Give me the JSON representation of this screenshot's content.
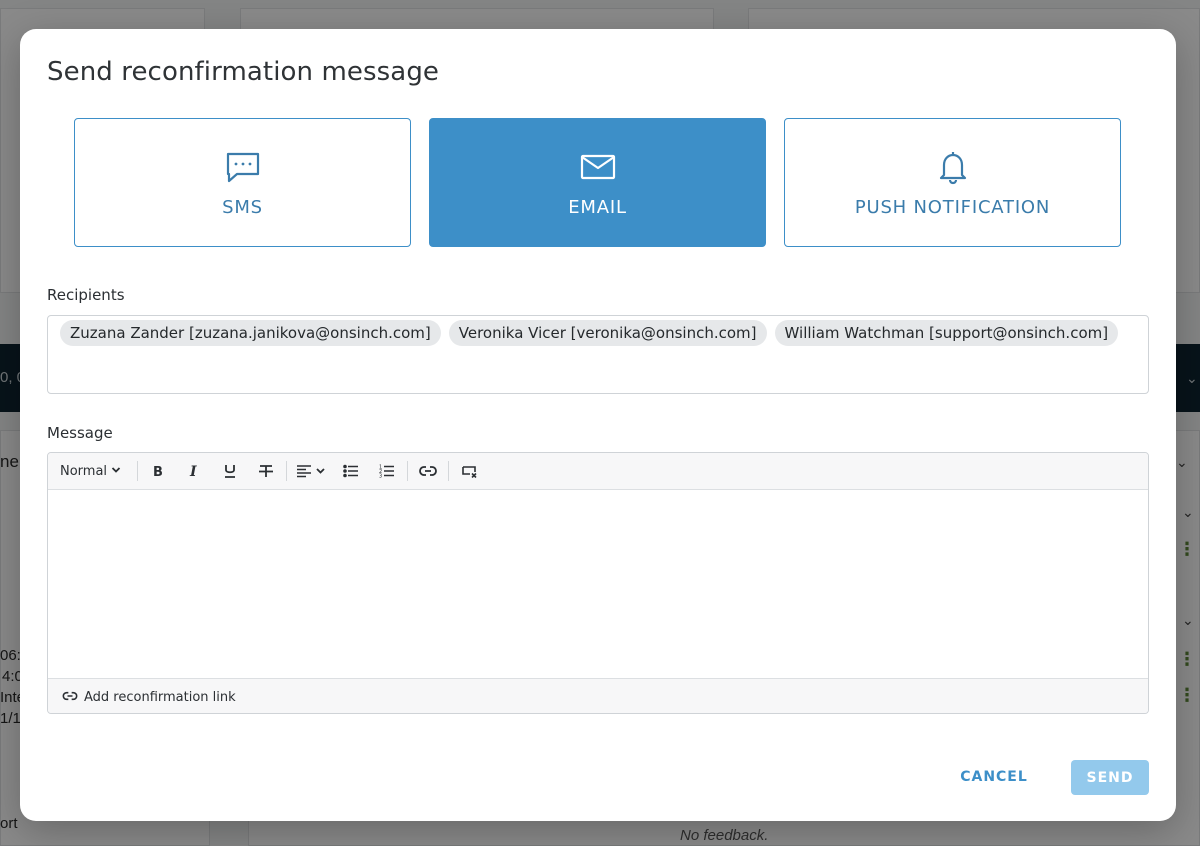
{
  "background": {
    "fragments": [
      "0, 0",
      "ne",
      "06:0",
      "4:0",
      "Inte",
      "1/1",
      "ort",
      "No feedback."
    ]
  },
  "modal": {
    "title": "Send reconfirmation message",
    "channels": [
      {
        "label": "SMS",
        "icon": "chat-bubble-icon",
        "selected": false
      },
      {
        "label": "EMAIL",
        "icon": "envelope-icon",
        "selected": true
      },
      {
        "label": "PUSH NOTIFICATION",
        "icon": "bell-icon",
        "selected": false
      }
    ],
    "recipients_label": "Recipients",
    "recipients": [
      "Zuzana Zander [zuzana.janikova@onsinch.com]",
      "Veronika Vicer [veronika@onsinch.com]",
      "William Watchman [support@onsinch.com]"
    ],
    "message_label": "Message",
    "toolbar": {
      "format_value": "Normal",
      "buttons": [
        "bold-icon",
        "italic-icon",
        "underline-icon",
        "strikethrough-icon",
        "align-icon",
        "bullet-list-icon",
        "ordered-list-icon",
        "link-icon",
        "clear-format-icon"
      ]
    },
    "message_value": "",
    "add_link_label": "Add reconfirmation link",
    "cancel_label": "CANCEL",
    "send_label": "SEND"
  },
  "colors": {
    "accent": "#3d8fc8",
    "send_disabled": "#93c9ec",
    "chip_bg": "#e6e8ea",
    "header_bar": "#0e2431"
  }
}
